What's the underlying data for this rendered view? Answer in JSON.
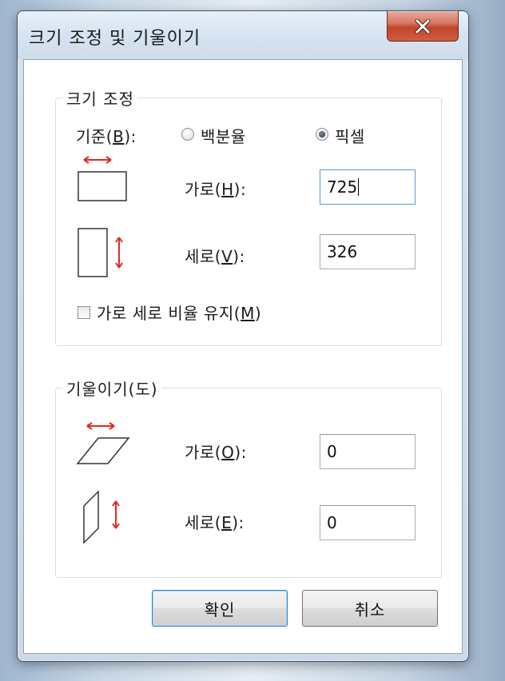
{
  "window": {
    "title": "크기 조정 및 기울이기",
    "close_glyph": "X"
  },
  "resize": {
    "group_title": "크기 조정",
    "basis_label": "기준(B):",
    "option_percent": "백분율",
    "option_pixel": "픽셀",
    "selected": "pixel",
    "horizontal_label": "가로(H):",
    "horizontal_value": "725",
    "vertical_label": "세로(V):",
    "vertical_value": "326",
    "keep_ratio_label": "가로 세로 비율 유지(M)",
    "keep_ratio_checked": false
  },
  "skew": {
    "group_title": "기울이기(도)",
    "horizontal_label": "가로(O):",
    "horizontal_value": "0",
    "vertical_label": "세로(E):",
    "vertical_value": "0"
  },
  "buttons": {
    "ok": "확인",
    "cancel": "취소"
  },
  "colors": {
    "arrow_red": "#e02b20",
    "close_red": "#c2442a",
    "focus_blue": "#5a9ad6"
  },
  "icons": [
    "close-icon",
    "horizontal-resize-icon",
    "vertical-resize-icon",
    "horizontal-skew-icon",
    "vertical-skew-icon"
  ]
}
